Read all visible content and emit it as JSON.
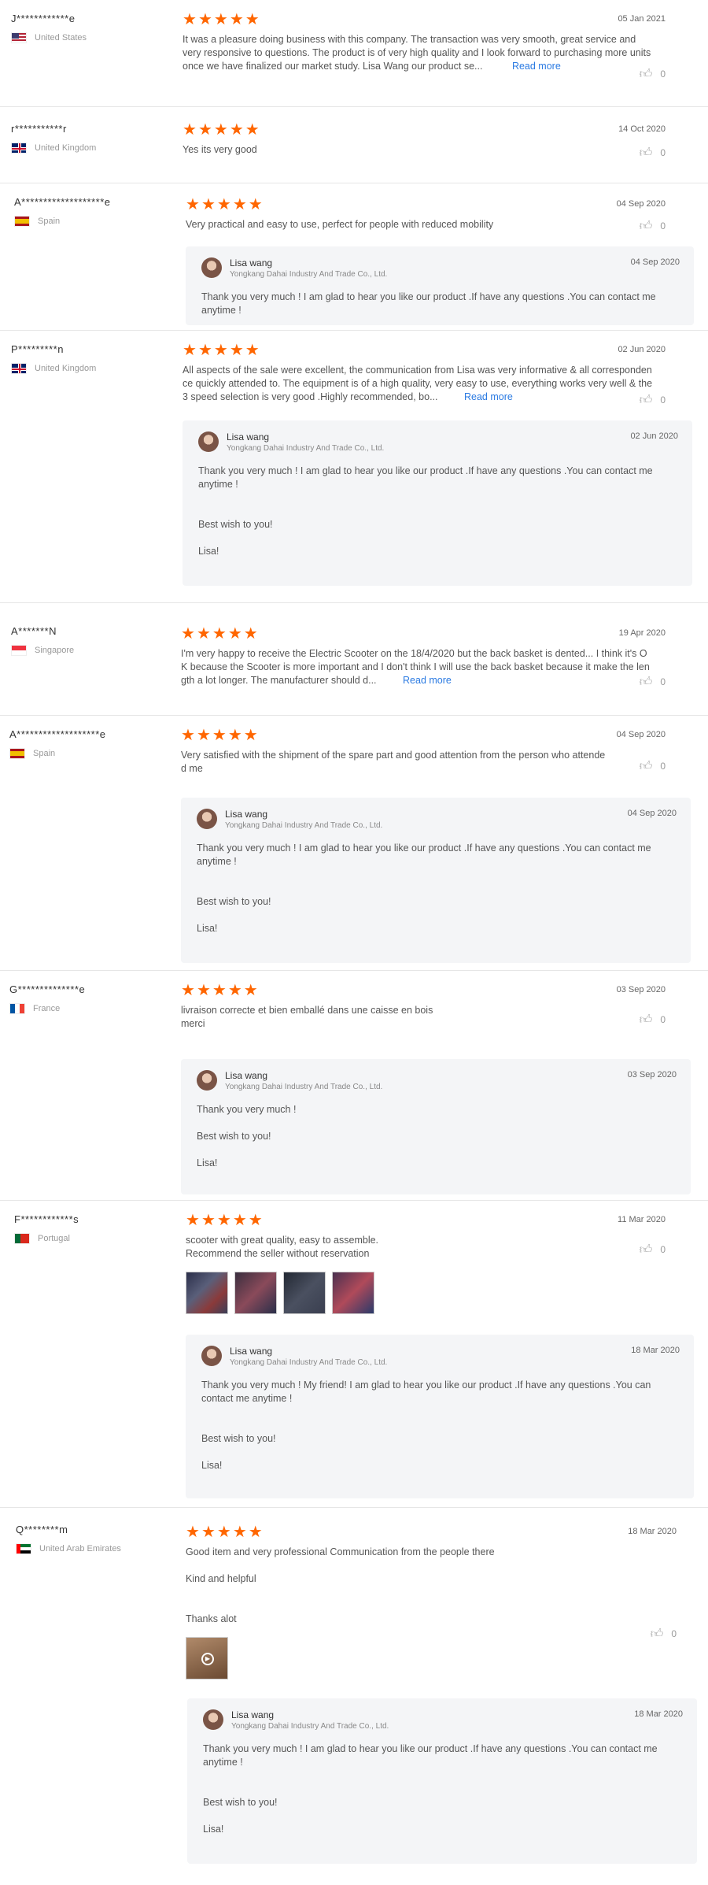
{
  "reviews": [
    {
      "buyer": "J************e",
      "country": "United States",
      "flag": "us",
      "rating": 5,
      "date": "05 Jan 2021",
      "text": [
        "It was a pleasure doing business with this company.  The transaction was very smooth, great service and very responsive to questions.  The product is of very high quality and I look forward to purchasing more units once we have finalized our market study. Lisa Wang our product se..."
      ],
      "read_more": "Read more",
      "likes": "0"
    },
    {
      "buyer": "r***********r",
      "country": "United Kingdom",
      "flag": "gb",
      "rating": 5,
      "date": "14 Oct 2020",
      "text": [
        "Yes its very good"
      ],
      "likes": "0"
    },
    {
      "buyer": "A*******************e",
      "country": "Spain",
      "flag": "es",
      "rating": 5,
      "date": "04 Sep 2020",
      "text": [
        "Very practical and easy to use, perfect for people with reduced mobility"
      ],
      "likes": "0",
      "reply": {
        "name": "Lisa wang",
        "company": "Yongkang Dahai Industry And Trade Co., Ltd.",
        "date": "04 Sep 2020",
        "lines": [
          "Thank you very much ! I am glad to hear you like our product .If have any questions .You can contact me anytime !"
        ]
      }
    },
    {
      "buyer": "P*********n",
      "country": "United Kingdom",
      "flag": "gb",
      "rating": 5,
      "date": "02 Jun 2020",
      "text": [
        "All aspects of the sale were excellent, the communication from Lisa was very informative & all correspondence quickly attended to. The equipment is of a high quality, very easy to use, everything works very well & the 3 speed selection is very good .Highly recommended, bo..."
      ],
      "read_more": "Read more",
      "likes": "0",
      "reply": {
        "name": "Lisa wang",
        "company": "Yongkang Dahai Industry And Trade Co., Ltd.",
        "date": "02 Jun 2020",
        "lines": [
          "Thank you very much ! I am glad to hear you like our product .If have any questions .You can contact me anytime !",
          "",
          "Best wish to you!",
          "Lisa!"
        ]
      }
    },
    {
      "buyer": "A*******N",
      "country": "Singapore",
      "flag": "sg",
      "rating": 5,
      "date": "19 Apr 2020",
      "text": [
        "I'm very happy to receive the Electric Scooter on the 18/4/2020 but the back basket is dented... I think it's OK because the Scooter is more important and I don't think I will use the back basket because it make the length a lot longer. The manufacturer should d..."
      ],
      "read_more": "Read more",
      "likes": "0"
    },
    {
      "buyer": "A*******************e",
      "country": "Spain",
      "flag": "es",
      "rating": 5,
      "date": "04 Sep 2020",
      "text": [
        "Very satisfied with the shipment of the spare part and good attention from the person who attended me"
      ],
      "likes": "0",
      "reply": {
        "name": "Lisa wang",
        "company": "Yongkang Dahai Industry And Trade Co., Ltd.",
        "date": "04 Sep 2020",
        "lines": [
          "Thank you very much ! I am glad to hear you like our product .If have any questions .You can contact me anytime !",
          "",
          "Best wish to you!",
          "Lisa!"
        ]
      }
    },
    {
      "buyer": "G**************e",
      "country": "France",
      "flag": "fr",
      "rating": 5,
      "date": "03 Sep 2020",
      "text": [
        "livraison correcte et bien emballé dans une caisse en bois",
        "merci"
      ],
      "likes": "0",
      "reply": {
        "name": "Lisa wang",
        "company": "Yongkang Dahai Industry And Trade Co., Ltd.",
        "date": "03 Sep 2020",
        "lines": [
          "Thank you very much !",
          "",
          "Best wish to you!",
          "Lisa!"
        ]
      }
    },
    {
      "buyer": "F************s",
      "country": "Portugal",
      "flag": "pt",
      "rating": 5,
      "date": "11 Mar 2020",
      "text": [
        "scooter with great quality, easy to assemble.",
        "Recommend the seller without reservation"
      ],
      "likes": "0",
      "photos": 4,
      "reply": {
        "name": "Lisa wang",
        "company": "Yongkang Dahai Industry And Trade Co., Ltd.",
        "date": "18 Mar 2020",
        "lines": [
          "Thank you very much ! My friend!  I am glad to hear you like our product .If have any questions .You can contact me anytime !",
          "",
          "Best wish to you!",
          "Lisa!"
        ]
      }
    },
    {
      "buyer": "Q********m",
      "country": "United Arab Emirates",
      "flag": "ae",
      "rating": 5,
      "date": "18 Mar 2020",
      "text": [
        "Good item and very professional Communication from the people there",
        "Kind and helpful",
        "Thanks alot"
      ],
      "likes": "0",
      "video": true,
      "reply": {
        "name": "Lisa wang",
        "company": "Yongkang Dahai Industry And Trade Co., Ltd.",
        "date": "18 Mar 2020",
        "lines": [
          "Thank you very much ! I am glad to hear you like our product .If have any questions .You can contact me anytime !",
          "",
          "Best wish to you!",
          "Lisa!"
        ]
      }
    }
  ],
  "icons": {
    "star": "star-icon",
    "like": "thumbs-up-icon",
    "play": "play-icon"
  },
  "colors": {
    "star": "#ff6600",
    "link": "#2a7ae2",
    "reply_bg": "#f4f5f7"
  }
}
